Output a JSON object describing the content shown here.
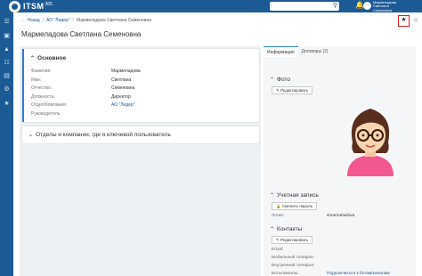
{
  "topbar": {
    "logo_text": "ITSM",
    "logo_version": "365",
    "user_name_line1": "Мармеладова",
    "user_name_line2": "Светлана",
    "user_name_line3": "Семеновна"
  },
  "sidebar": {
    "icons": [
      "menu-icon",
      "monitor-icon",
      "cart-icon",
      "org-icon",
      "book-icon",
      "settings-icon",
      "star-icon"
    ]
  },
  "breadcrumb": {
    "back": "← Назад",
    "company": "АО \"Лидер\"",
    "person": "Мармеладова Светлана Семеновна"
  },
  "page_title": "Мармеладова Светлана Семеновна",
  "main_card": {
    "title": "Основное",
    "fields": [
      {
        "label": "Фамилия:",
        "value": "Мармеладова",
        "link": false
      },
      {
        "label": "Имя:",
        "value": "Светлана",
        "link": false
      },
      {
        "label": "Отчество:",
        "value": "Семеновна",
        "link": false
      },
      {
        "label": "Должность:",
        "value": "Директор",
        "link": false
      },
      {
        "label": "Отдел/Компания:",
        "value": "АО \"Лидер\"",
        "link": true
      },
      {
        "label": "Руководитель:",
        "value": "",
        "link": false
      }
    ]
  },
  "companies_card": {
    "title": "Отделы и компании, где я ключевой пользователь"
  },
  "tabs": {
    "info": "Информация",
    "contracts": "Договоры (2)"
  },
  "photo": {
    "title": "Фото",
    "edit_button": "Редактировать"
  },
  "account": {
    "title": "Учетная запись",
    "change_password_button": "Сменить пароль",
    "login_label": "Логин:",
    "login_value": "smarmeladova"
  },
  "contacts": {
    "title": "Контакты",
    "edit_button": "Редактировать",
    "email_label": "Email:",
    "mobile_label": "Мобильный телефон:",
    "internal_label": "Внутренний телефон:",
    "bots_label": "Боты/каналы:",
    "bots_link": "Подключиться к ботам/каналам"
  },
  "colors": {
    "brand": "#1c5a96",
    "accent": "#2b7fd4",
    "highlight": "#d62020"
  }
}
